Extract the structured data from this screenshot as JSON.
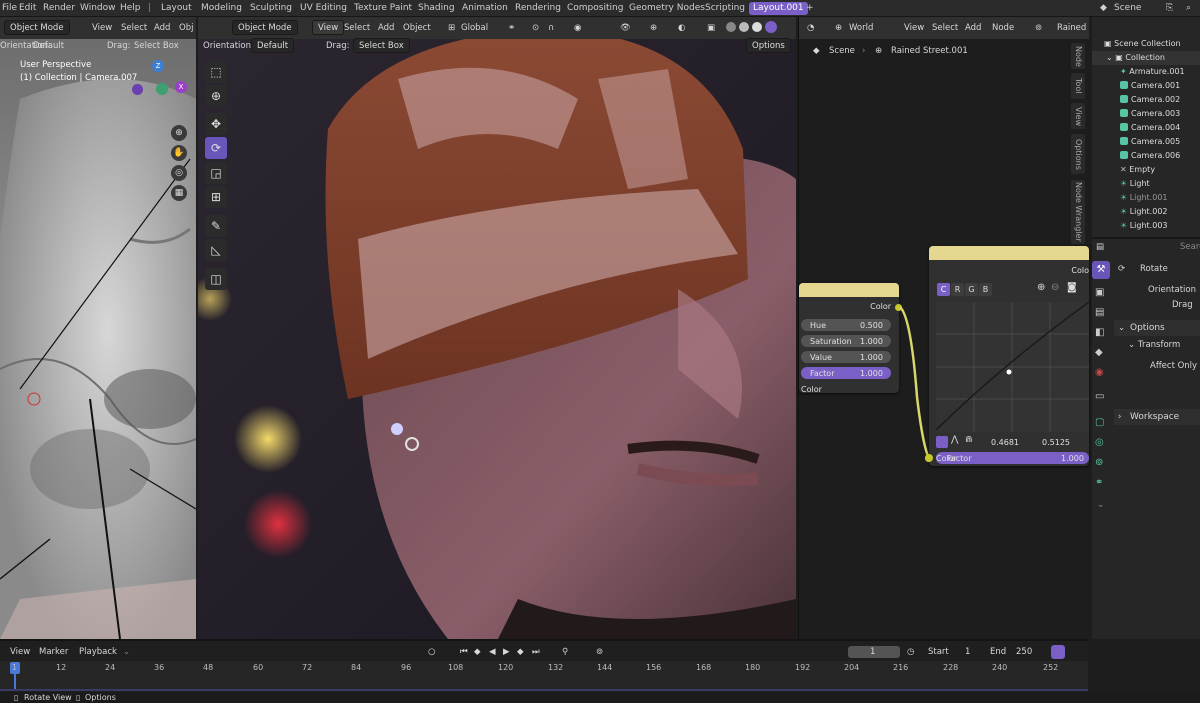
{
  "topbar": {
    "menus": [
      "File",
      "Edit",
      "Render",
      "Window",
      "Help"
    ],
    "workspaces": [
      "Layout",
      "Modeling",
      "Sculpting",
      "UV Editing",
      "Texture Paint",
      "Shading",
      "Animation",
      "Rendering",
      "Compositing",
      "Geometry Nodes",
      "Scripting",
      "Layout.001"
    ],
    "active_workspace": "Layout.001",
    "scene_label": "Scene",
    "search_placeholder": "Search"
  },
  "left_viewport": {
    "mode": "Object Mode",
    "menus": [
      "View",
      "Select",
      "Add",
      "Obj"
    ],
    "orientation_label": "Orientation:",
    "orientation_value": "Default",
    "drag_label": "Drag:",
    "drag_value": "Select Box",
    "overlay_line1": "User Perspective",
    "overlay_line2": "(1) Collection | Camera.007",
    "gizmo_axis_z": "Z",
    "gizmo_axis_x": "X"
  },
  "main_viewport": {
    "mode": "Object Mode",
    "menus": [
      "View",
      "Select",
      "Add",
      "Object"
    ],
    "transform_space": "Global",
    "orientation_label": "Orientation:",
    "orientation_value": "Default",
    "drag_label": "Drag:",
    "drag_value": "Select Box",
    "options_label": "Options"
  },
  "node_editor": {
    "world_label": "World",
    "menus": [
      "View",
      "Select",
      "Add",
      "Node"
    ],
    "world_name": "Rained",
    "breadcrumb_scene": "Scene",
    "breadcrumb_world": "Rained Street.001",
    "side_tabs": [
      "Node",
      "Tool",
      "View",
      "Options",
      "Node Wrangler"
    ],
    "hsv_node": {
      "output_label": "Color",
      "fields": [
        {
          "label": "Hue",
          "value": "0.500"
        },
        {
          "label": "Saturation",
          "value": "1.000"
        },
        {
          "label": "Value",
          "value": "1.000"
        },
        {
          "label": "Factor",
          "value": "1.000"
        }
      ],
      "input_label": "Color"
    },
    "curves_node": {
      "output_label": "Colo",
      "channels": [
        "C",
        "R",
        "G",
        "B"
      ],
      "point_x": "0.4681",
      "point_y": "0.5125",
      "factor_label": "Factor",
      "factor_value": "1.000",
      "input_label": "Color"
    }
  },
  "outliner": {
    "root": "Scene Collection",
    "collection": "Collection",
    "items": [
      "Armature.001",
      "Camera.001",
      "Camera.002",
      "Camera.003",
      "Camera.004",
      "Camera.005",
      "Camera.006",
      "Empty",
      "Light",
      "Light.001",
      "Light.002",
      "Light.003"
    ]
  },
  "properties": {
    "search_placeholder": "Searc",
    "tool_name": "Rotate",
    "orientation_label": "Orientation",
    "drag_label": "Drag",
    "options_label": "Options",
    "transform_label": "Transform",
    "affect_only_label": "Affect Only",
    "workspace_label": "Workspace"
  },
  "timeline": {
    "menus": [
      "View",
      "Marker",
      "Playback"
    ],
    "current_frame": "1",
    "start_label": "Start",
    "start_value": "1",
    "end_label": "End",
    "end_value": "250",
    "ruler": [
      "1",
      "12",
      "24",
      "36",
      "48",
      "60",
      "72",
      "84",
      "96",
      "108",
      "120",
      "132",
      "144",
      "156",
      "168",
      "180",
      "192",
      "204",
      "216",
      "228",
      "240",
      "252"
    ],
    "status_rotate": "Rotate View",
    "status_options": "Options"
  },
  "colors": {
    "accent": "#7a5fc7",
    "node_header": "#e6d790",
    "camera_icon": "#57c4a3"
  }
}
